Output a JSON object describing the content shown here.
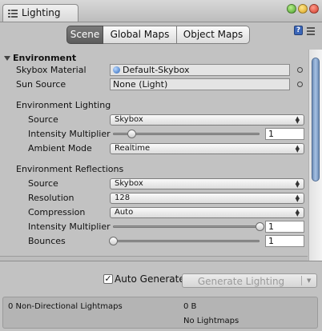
{
  "window": {
    "tab_title": "Lighting",
    "tab_icon": "lightbulb-list-icon"
  },
  "toolbar": {
    "tabs": [
      "Scene",
      "Global Maps",
      "Object Maps"
    ],
    "active_tab": "Scene",
    "help_icon_label": "?"
  },
  "environment": {
    "title": "Environment",
    "skybox_material": {
      "label": "Skybox Material",
      "value": "Default-Skybox",
      "icon": "globe-icon"
    },
    "sun_source": {
      "label": "Sun Source",
      "value": "None (Light)"
    }
  },
  "environment_lighting": {
    "title": "Environment Lighting",
    "source": {
      "label": "Source",
      "value": "Skybox"
    },
    "intensity": {
      "label": "Intensity Multiplier",
      "value": "1",
      "slider_fraction": 0.125
    },
    "ambient_mode": {
      "label": "Ambient Mode",
      "value": "Realtime"
    }
  },
  "environment_reflections": {
    "title": "Environment Reflections",
    "source": {
      "label": "Source",
      "value": "Skybox"
    },
    "resolution": {
      "label": "Resolution",
      "value": "128"
    },
    "compression": {
      "label": "Compression",
      "value": "Auto"
    },
    "intensity": {
      "label": "Intensity Multiplier",
      "value": "1",
      "slider_fraction": 1.0
    },
    "bounces": {
      "label": "Bounces",
      "value": "1",
      "slider_fraction": 0.0
    }
  },
  "bottom": {
    "auto_generate": {
      "label": "Auto Generate",
      "checked": true,
      "mark": "✓"
    },
    "generate_button": "Generate Lighting",
    "stats": {
      "lightmaps_count": "0 Non-Directional Lightmaps",
      "lightmaps_size": "0 B",
      "lightmaps_status": "No Lightmaps"
    }
  },
  "colors": {
    "panel_bg": "#c2c2c2",
    "active_tab_bg": "#5c5c5c",
    "scroll_thumb": "#8eaad0"
  }
}
